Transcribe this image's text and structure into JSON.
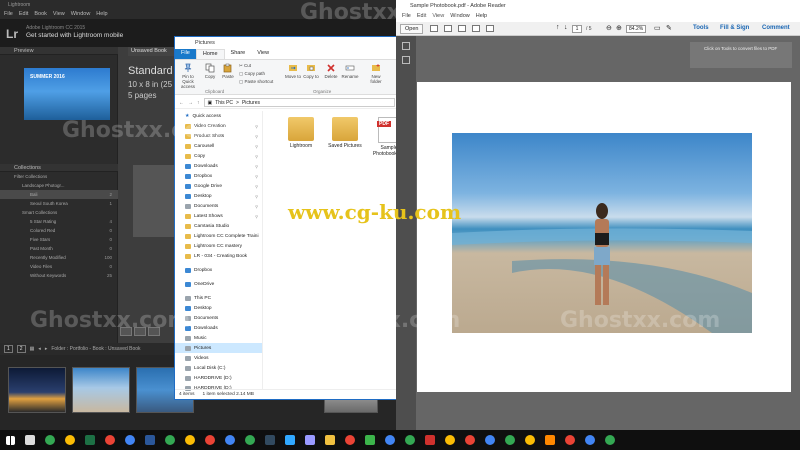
{
  "lightroom": {
    "title": "Lightroom",
    "menu": [
      "File",
      "Edit",
      "Book",
      "View",
      "Window",
      "Help"
    ],
    "version": "Adobe Lightroom CC 2015",
    "mobile_banner": "Get started with Lightroom mobile",
    "logo": "Lr",
    "preview_header": "Preview",
    "preview_thumb_text": "SUMMER 2016",
    "unsaved_tab": "Unsaved Book",
    "book_title": "Standard",
    "book_size": "10 x 8 in (25",
    "book_pages": "5 pages",
    "collections_header": "Collections",
    "collections": [
      {
        "name": "Filter Collections",
        "count": ""
      },
      {
        "name": "Landscape Photogr...",
        "count": ""
      },
      {
        "name": "Bali",
        "count": "2"
      },
      {
        "name": "Seoul South Korea",
        "count": "1"
      },
      {
        "name": "Smart Collections",
        "count": ""
      },
      {
        "name": "5 Star Rating",
        "count": "4"
      },
      {
        "name": "Colored Red",
        "count": "0"
      },
      {
        "name": "Five Stars",
        "count": "0"
      },
      {
        "name": "Past Month",
        "count": "0"
      },
      {
        "name": "Recently Modified",
        "count": "100"
      },
      {
        "name": "Video Files",
        "count": "0"
      },
      {
        "name": "Without Keywords",
        "count": "25"
      }
    ],
    "filmstrip_bar": {
      "page1": "1",
      "page2": "2",
      "path": "Folder : Portfolio - Book : Unsaved Book"
    }
  },
  "explorer": {
    "title": "Pictures",
    "tabs": [
      "File",
      "Home",
      "Share",
      "View"
    ],
    "ribbon": {
      "pin": "Pin to Quick access",
      "copy": "Copy",
      "paste": "Paste",
      "cut": "Cut",
      "copy_path": "Copy path",
      "paste_shortcut": "Paste shortcut",
      "move_to": "Move to",
      "copy_to": "Copy to",
      "delete": "Delete",
      "rename": "Rename",
      "new_folder": "New folder",
      "clipboard": "Clipboard",
      "organize": "Organize"
    },
    "address": [
      "This PC",
      ">",
      "Pictures"
    ],
    "nav": [
      {
        "label": "Quick access",
        "type": "star"
      },
      {
        "label": "Video Creation",
        "type": "folder",
        "pin": true
      },
      {
        "label": "Product Shots",
        "type": "folder",
        "pin": true
      },
      {
        "label": "Carousell",
        "type": "folder",
        "pin": true
      },
      {
        "label": "Copy",
        "type": "folder",
        "pin": true
      },
      {
        "label": "Downloads",
        "type": "blue",
        "pin": true
      },
      {
        "label": "Dropbox",
        "type": "blue",
        "pin": true
      },
      {
        "label": "Google Drive",
        "type": "blue",
        "pin": true
      },
      {
        "label": "Desktop",
        "type": "blue",
        "pin": true
      },
      {
        "label": "Documents",
        "type": "gray",
        "pin": true
      },
      {
        "label": "Latest Shows",
        "type": "folder",
        "pin": true
      },
      {
        "label": "Camtasia Studio",
        "type": "folder"
      },
      {
        "label": "Lightroom CC Complete Traini",
        "type": "folder"
      },
      {
        "label": "Lightroom CC mastery",
        "type": "folder"
      },
      {
        "label": "LR - 034 - Creating Book",
        "type": "folder"
      },
      {
        "label": "",
        "type": "spacer"
      },
      {
        "label": "Dropbox",
        "type": "blue"
      },
      {
        "label": "",
        "type": "spacer"
      },
      {
        "label": "OneDrive",
        "type": "blue"
      },
      {
        "label": "",
        "type": "spacer"
      },
      {
        "label": "This PC",
        "type": "gray"
      },
      {
        "label": "Desktop",
        "type": "blue"
      },
      {
        "label": "Documents",
        "type": "gray"
      },
      {
        "label": "Downloads",
        "type": "blue"
      },
      {
        "label": "Music",
        "type": "gray"
      },
      {
        "label": "Pictures",
        "type": "gray",
        "selected": true
      },
      {
        "label": "Videos",
        "type": "gray"
      },
      {
        "label": "Local Disk (C:)",
        "type": "gray"
      },
      {
        "label": "HARDDRIVE (D:)",
        "type": "gray"
      },
      {
        "label": "HARDDRIVE (D:)",
        "type": "gray"
      }
    ],
    "items": [
      {
        "label": "Lightroom",
        "kind": "folder"
      },
      {
        "label": "Saved Pictures",
        "kind": "folder"
      },
      {
        "label": "Sample Photobook.pdf",
        "kind": "pdf"
      }
    ],
    "status": {
      "count": "4 items",
      "selected": "1 item selected  2.14 MB"
    }
  },
  "reader": {
    "title": "Sample Photobook.pdf - Adobe Reader",
    "menu": [
      "File",
      "Edit",
      "View",
      "Window",
      "Help"
    ],
    "open": "Open",
    "page_current": "1",
    "page_total": "/ 5",
    "zoom": "84.2%",
    "tools": "Tools",
    "fill_sign": "Fill & Sign",
    "comment": "Comment",
    "hint": "Click on Tools to convert files to PDF"
  },
  "taskbar": {
    "icons": [
      {
        "name": "start",
        "color": "#ffffff"
      },
      {
        "name": "search",
        "color": "#dddddd"
      },
      {
        "name": "chrome",
        "color": "#34a853"
      },
      {
        "name": "chrome",
        "color": "#fbbc05"
      },
      {
        "name": "excel",
        "color": "#1d7044"
      },
      {
        "name": "chrome",
        "color": "#ea4335"
      },
      {
        "name": "chrome",
        "color": "#4285f4"
      },
      {
        "name": "word",
        "color": "#2b579a"
      },
      {
        "name": "chrome",
        "color": "#34a853"
      },
      {
        "name": "chrome",
        "color": "#fbbc05"
      },
      {
        "name": "chrome",
        "color": "#ea4335"
      },
      {
        "name": "chrome",
        "color": "#4285f4"
      },
      {
        "name": "chrome",
        "color": "#34a853"
      },
      {
        "name": "lightroom",
        "color": "#324a5f"
      },
      {
        "name": "photoshop",
        "color": "#31a8ff"
      },
      {
        "name": "premiere",
        "color": "#9999ff"
      },
      {
        "name": "explorer",
        "color": "#f0c040"
      },
      {
        "name": "chrome",
        "color": "#ea4335"
      },
      {
        "name": "camtasia",
        "color": "#3cb44b"
      },
      {
        "name": "chrome",
        "color": "#4285f4"
      },
      {
        "name": "chrome",
        "color": "#34a853"
      },
      {
        "name": "acrobat",
        "color": "#d0312d"
      },
      {
        "name": "chrome",
        "color": "#fbbc05"
      },
      {
        "name": "chrome",
        "color": "#ea4335"
      },
      {
        "name": "chrome",
        "color": "#4285f4"
      },
      {
        "name": "chrome",
        "color": "#34a853"
      },
      {
        "name": "chrome",
        "color": "#fbbc05"
      },
      {
        "name": "vlc",
        "color": "#ff8800"
      },
      {
        "name": "chrome",
        "color": "#ea4335"
      },
      {
        "name": "chrome",
        "color": "#4285f4"
      },
      {
        "name": "chrome",
        "color": "#34a853"
      }
    ]
  },
  "watermarks": {
    "site": "Ghostxx.com",
    "url": "www.cg-ku.com"
  }
}
